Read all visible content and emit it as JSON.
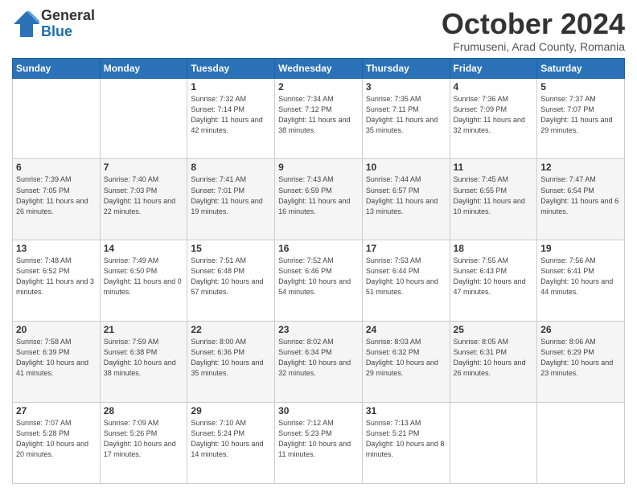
{
  "logo": {
    "general": "General",
    "blue": "Blue"
  },
  "header": {
    "month": "October 2024",
    "location": "Frumuseni, Arad County, Romania"
  },
  "weekdays": [
    "Sunday",
    "Monday",
    "Tuesday",
    "Wednesday",
    "Thursday",
    "Friday",
    "Saturday"
  ],
  "weeks": [
    [
      {
        "day": "",
        "info": ""
      },
      {
        "day": "",
        "info": ""
      },
      {
        "day": "1",
        "info": "Sunrise: 7:32 AM\nSunset: 7:14 PM\nDaylight: 11 hours and 42 minutes."
      },
      {
        "day": "2",
        "info": "Sunrise: 7:34 AM\nSunset: 7:12 PM\nDaylight: 11 hours and 38 minutes."
      },
      {
        "day": "3",
        "info": "Sunrise: 7:35 AM\nSunset: 7:11 PM\nDaylight: 11 hours and 35 minutes."
      },
      {
        "day": "4",
        "info": "Sunrise: 7:36 AM\nSunset: 7:09 PM\nDaylight: 11 hours and 32 minutes."
      },
      {
        "day": "5",
        "info": "Sunrise: 7:37 AM\nSunset: 7:07 PM\nDaylight: 11 hours and 29 minutes."
      }
    ],
    [
      {
        "day": "6",
        "info": "Sunrise: 7:39 AM\nSunset: 7:05 PM\nDaylight: 11 hours and 26 minutes."
      },
      {
        "day": "7",
        "info": "Sunrise: 7:40 AM\nSunset: 7:03 PM\nDaylight: 11 hours and 22 minutes."
      },
      {
        "day": "8",
        "info": "Sunrise: 7:41 AM\nSunset: 7:01 PM\nDaylight: 11 hours and 19 minutes."
      },
      {
        "day": "9",
        "info": "Sunrise: 7:43 AM\nSunset: 6:59 PM\nDaylight: 11 hours and 16 minutes."
      },
      {
        "day": "10",
        "info": "Sunrise: 7:44 AM\nSunset: 6:57 PM\nDaylight: 11 hours and 13 minutes."
      },
      {
        "day": "11",
        "info": "Sunrise: 7:45 AM\nSunset: 6:55 PM\nDaylight: 11 hours and 10 minutes."
      },
      {
        "day": "12",
        "info": "Sunrise: 7:47 AM\nSunset: 6:54 PM\nDaylight: 11 hours and 6 minutes."
      }
    ],
    [
      {
        "day": "13",
        "info": "Sunrise: 7:48 AM\nSunset: 6:52 PM\nDaylight: 11 hours and 3 minutes."
      },
      {
        "day": "14",
        "info": "Sunrise: 7:49 AM\nSunset: 6:50 PM\nDaylight: 11 hours and 0 minutes."
      },
      {
        "day": "15",
        "info": "Sunrise: 7:51 AM\nSunset: 6:48 PM\nDaylight: 10 hours and 57 minutes."
      },
      {
        "day": "16",
        "info": "Sunrise: 7:52 AM\nSunset: 6:46 PM\nDaylight: 10 hours and 54 minutes."
      },
      {
        "day": "17",
        "info": "Sunrise: 7:53 AM\nSunset: 6:44 PM\nDaylight: 10 hours and 51 minutes."
      },
      {
        "day": "18",
        "info": "Sunrise: 7:55 AM\nSunset: 6:43 PM\nDaylight: 10 hours and 47 minutes."
      },
      {
        "day": "19",
        "info": "Sunrise: 7:56 AM\nSunset: 6:41 PM\nDaylight: 10 hours and 44 minutes."
      }
    ],
    [
      {
        "day": "20",
        "info": "Sunrise: 7:58 AM\nSunset: 6:39 PM\nDaylight: 10 hours and 41 minutes."
      },
      {
        "day": "21",
        "info": "Sunrise: 7:59 AM\nSunset: 6:38 PM\nDaylight: 10 hours and 38 minutes."
      },
      {
        "day": "22",
        "info": "Sunrise: 8:00 AM\nSunset: 6:36 PM\nDaylight: 10 hours and 35 minutes."
      },
      {
        "day": "23",
        "info": "Sunrise: 8:02 AM\nSunset: 6:34 PM\nDaylight: 10 hours and 32 minutes."
      },
      {
        "day": "24",
        "info": "Sunrise: 8:03 AM\nSunset: 6:32 PM\nDaylight: 10 hours and 29 minutes."
      },
      {
        "day": "25",
        "info": "Sunrise: 8:05 AM\nSunset: 6:31 PM\nDaylight: 10 hours and 26 minutes."
      },
      {
        "day": "26",
        "info": "Sunrise: 8:06 AM\nSunset: 6:29 PM\nDaylight: 10 hours and 23 minutes."
      }
    ],
    [
      {
        "day": "27",
        "info": "Sunrise: 7:07 AM\nSunset: 5:28 PM\nDaylight: 10 hours and 20 minutes."
      },
      {
        "day": "28",
        "info": "Sunrise: 7:09 AM\nSunset: 5:26 PM\nDaylight: 10 hours and 17 minutes."
      },
      {
        "day": "29",
        "info": "Sunrise: 7:10 AM\nSunset: 5:24 PM\nDaylight: 10 hours and 14 minutes."
      },
      {
        "day": "30",
        "info": "Sunrise: 7:12 AM\nSunset: 5:23 PM\nDaylight: 10 hours and 11 minutes."
      },
      {
        "day": "31",
        "info": "Sunrise: 7:13 AM\nSunset: 5:21 PM\nDaylight: 10 hours and 8 minutes."
      },
      {
        "day": "",
        "info": ""
      },
      {
        "day": "",
        "info": ""
      }
    ]
  ]
}
